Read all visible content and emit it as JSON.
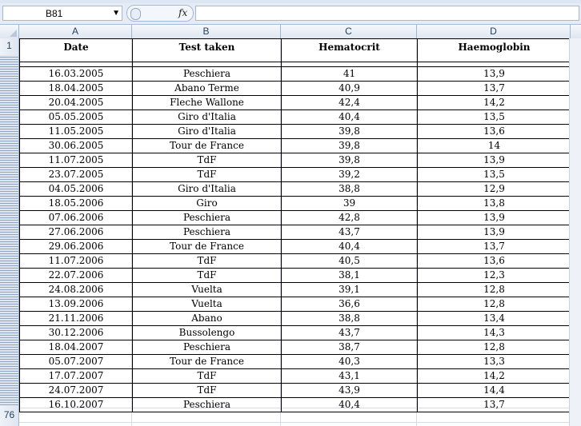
{
  "formula_bar": {
    "name_box": "B81",
    "fx_label": "fx",
    "formula": ""
  },
  "columns": [
    "A",
    "B",
    "C",
    "D"
  ],
  "row_labels": {
    "first": "1",
    "last": "76"
  },
  "table": {
    "headers": [
      "Date",
      "Test taken",
      "Hematocrit",
      "Haemoglobin"
    ],
    "rows": [
      [
        "16.03.2005",
        "Peschiera",
        "41",
        "13,9"
      ],
      [
        "18.04.2005",
        "Abano Terme",
        "40,9",
        "13,7"
      ],
      [
        "20.04.2005",
        "Fleche Wallone",
        "42,4",
        "14,2"
      ],
      [
        "05.05.2005",
        "Giro d'Italia",
        "40,4",
        "13,5"
      ],
      [
        "11.05.2005",
        "Giro d'Italia",
        "39,8",
        "13,6"
      ],
      [
        "30.06.2005",
        "Tour de France",
        "39,8",
        "14"
      ],
      [
        "11.07.2005",
        "TdF",
        "39,8",
        "13,9"
      ],
      [
        "23.07.2005",
        "TdF",
        "39,2",
        "13,5"
      ],
      [
        "04.05.2006",
        "Giro d'Italia",
        "38,8",
        "12,9"
      ],
      [
        "18.05.2006",
        "Giro",
        "39",
        "13,8"
      ],
      [
        "07.06.2006",
        "Peschiera",
        "42,8",
        "13,9"
      ],
      [
        "27.06.2006",
        "Peschiera",
        "43,7",
        "13,9"
      ],
      [
        "29.06.2006",
        "Tour de France",
        "40,4",
        "13,7"
      ],
      [
        "11.07.2006",
        "TdF",
        "40,5",
        "13,6"
      ],
      [
        "22.07.2006",
        "TdF",
        "38,1",
        "12,3"
      ],
      [
        "24.08.2006",
        "Vuelta",
        "39,1",
        "12,8"
      ],
      [
        "13.09.2006",
        "Vuelta",
        "36,6",
        "12,8"
      ],
      [
        "21.11.2006",
        "Abano",
        "38,8",
        "13,4"
      ],
      [
        "30.12.2006",
        "Bussolengo",
        "43,7",
        "14,3"
      ],
      [
        "18.04.2007",
        "Peschiera",
        "38,7",
        "12,8"
      ],
      [
        "05.07.2007",
        "Tour de France",
        "40,3",
        "13,3"
      ],
      [
        "17.07.2007",
        "TdF",
        "43,1",
        "14,2"
      ],
      [
        "24.07.2007",
        "TdF",
        "43,9",
        "14,4"
      ],
      [
        "16.10.2007",
        "Peschiera",
        "40,4",
        "13,7"
      ]
    ]
  }
}
